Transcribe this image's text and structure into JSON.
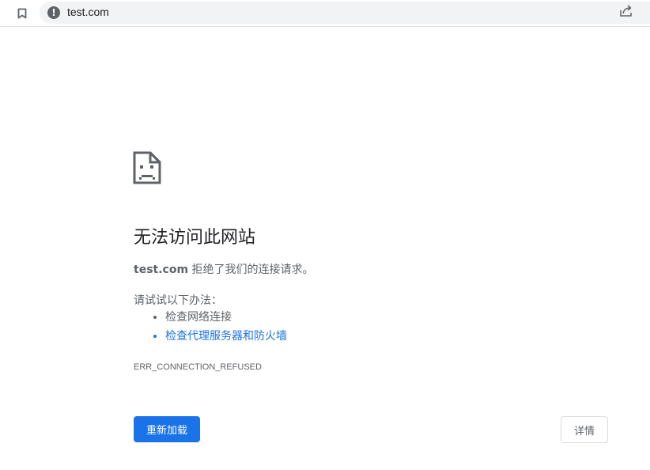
{
  "browser": {
    "url": "test.com",
    "icons": {
      "bookmark": "bookmark-icon",
      "site_info": "info-icon",
      "share": "share-icon"
    }
  },
  "error": {
    "icon": "sad-page-icon",
    "title": "无法访问此网站",
    "host": "test.com",
    "description": " 拒绝了我们的连接请求。",
    "try_label": "请试试以下办法：",
    "suggestions": [
      "检查网络连接",
      "检查代理服务器和防火墙"
    ],
    "code": "ERR_CONNECTION_REFUSED"
  },
  "buttons": {
    "reload_label": "重新加载",
    "details_label": "详情"
  },
  "colors": {
    "accent": "#1a73e8",
    "text_secondary": "#5f6368",
    "omnibox_bg": "#f1f3f4"
  }
}
